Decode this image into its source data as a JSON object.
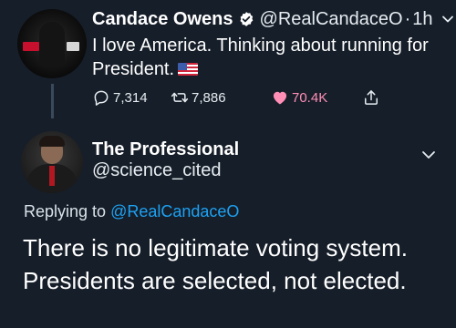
{
  "tweet": {
    "author_name": "Candace Owens",
    "author_handle": "@RealCandaceO",
    "separator": "·",
    "time": "1h",
    "text": "I love America. Thinking about running for President.",
    "flag_icon": "us-flag-icon",
    "actions": {
      "replies": "7,314",
      "retweets": "7,886",
      "likes": "70.4K"
    }
  },
  "reply": {
    "author_name": "The Professional",
    "author_handle": "@science_cited",
    "replying_prefix": "Replying to",
    "replying_handle": "@RealCandaceO",
    "text": "There is no legitimate voting system. Presidents are selected, not elected."
  },
  "colors": {
    "background": "#161e29",
    "link": "#1da1f2",
    "like_active": "#ff8fb6",
    "thread_line": "#3a4a5c",
    "secondary_text": "#e6ecf0"
  },
  "icons": [
    "verified-badge-icon",
    "chevron-down-icon",
    "reply-icon",
    "retweet-icon",
    "heart-icon",
    "share-icon",
    "us-flag-icon"
  ]
}
